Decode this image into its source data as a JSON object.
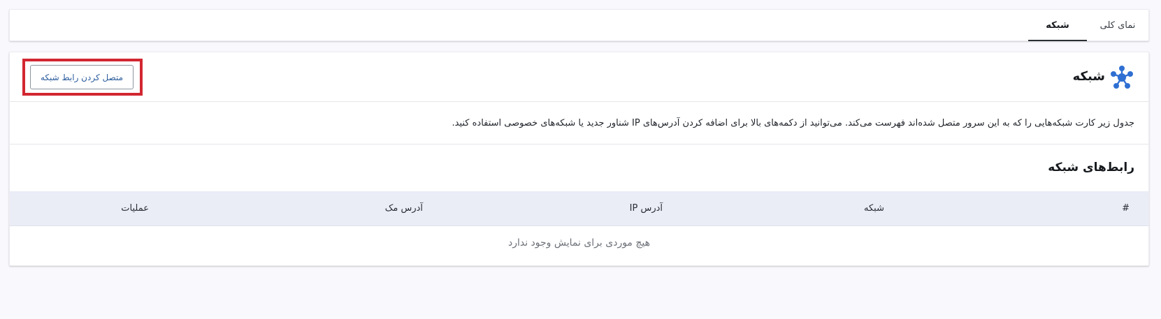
{
  "tabs": {
    "overview": "نمای کلی",
    "network": "شبکه"
  },
  "card": {
    "title": "شبکه",
    "icon": "network-hub-icon",
    "icon_color": "#2f6fd2",
    "connect_button": "متصل کردن رابط شبکه",
    "highlight_color": "#d22731",
    "description": "جدول زیر کارت شبکه‌هایی را که به این سرور متصل شده‌اند فهرست می‌کند. می‌توانید از دکمه‌های بالا برای اضافه کردن آدرس‌های IP شناور جدید یا شبکه‌های خصوصی استفاده کنید."
  },
  "interfaces": {
    "title": "رابط‌های شبکه",
    "columns": {
      "index": "#",
      "network": "شبکه",
      "ip": "آدرس IP",
      "mac": "آدرس مک",
      "operations": "عملیات"
    },
    "empty_message": "هیچ موردی برای نمایش وجود ندارد"
  }
}
